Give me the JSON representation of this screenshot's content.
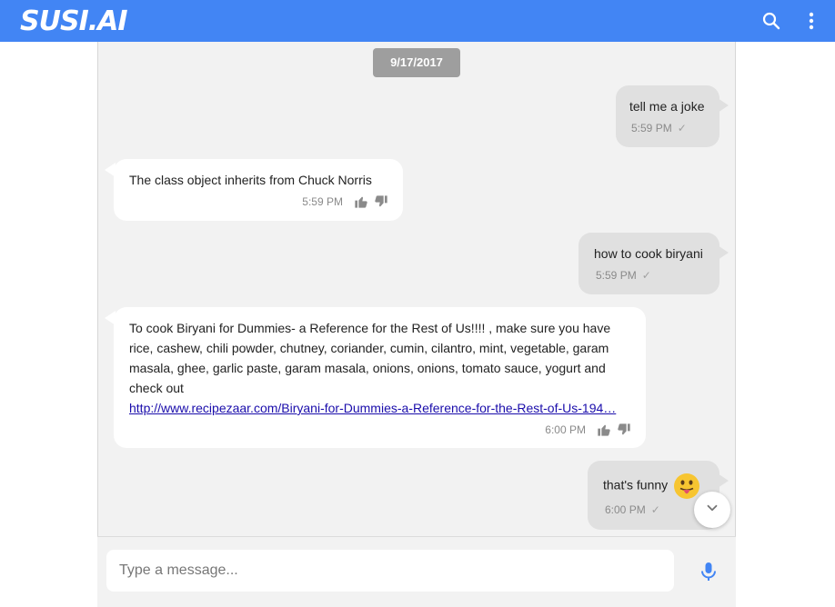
{
  "app": {
    "logo_text": "SUSI.AI",
    "brand_color": "#4285f4",
    "icons": {
      "search": "search-icon",
      "menu": "more-vert-icon"
    }
  },
  "chat": {
    "date_chip": "9/17/2017",
    "messages": [
      {
        "from": "user",
        "text": "tell me a joke",
        "time": "5:59 PM",
        "status_icon": "check-icon"
      },
      {
        "from": "bot",
        "text": "The class object inherits from Chuck Norris",
        "time": "5:59 PM",
        "icons": [
          "thumbs-up-icon",
          "thumbs-down-icon"
        ]
      },
      {
        "from": "user",
        "text": "how to cook biryani",
        "time": "5:59 PM",
        "status_icon": "check-icon"
      },
      {
        "from": "bot",
        "text": "To cook Biryani for Dummies- a Reference for the Rest of Us!!!! , make sure you have rice, cashew, chili powder, chutney, coriander, cumin, cilantro, mint, vegetable, garam masala, ghee, garlic paste, garam masala, onions, onions, tomato sauce, yogurt and check out",
        "link": "http://www.recipezaar.com/Biryani-for-Dummies-a-Reference-for-the-Rest-of-Us-194…",
        "time": "6:00 PM",
        "icons": [
          "thumbs-up-icon",
          "thumbs-down-icon"
        ]
      },
      {
        "from": "user",
        "text": "that's funny",
        "emoji": "tongue-out-emoji",
        "time": "6:00 PM",
        "status_icon": "check-icon"
      }
    ]
  },
  "composer": {
    "placeholder": "Type a message...",
    "value": "",
    "mic_icon": "microphone-icon",
    "mic_color": "#4285f4"
  },
  "scroll_down_icon": "chevron-down-icon"
}
